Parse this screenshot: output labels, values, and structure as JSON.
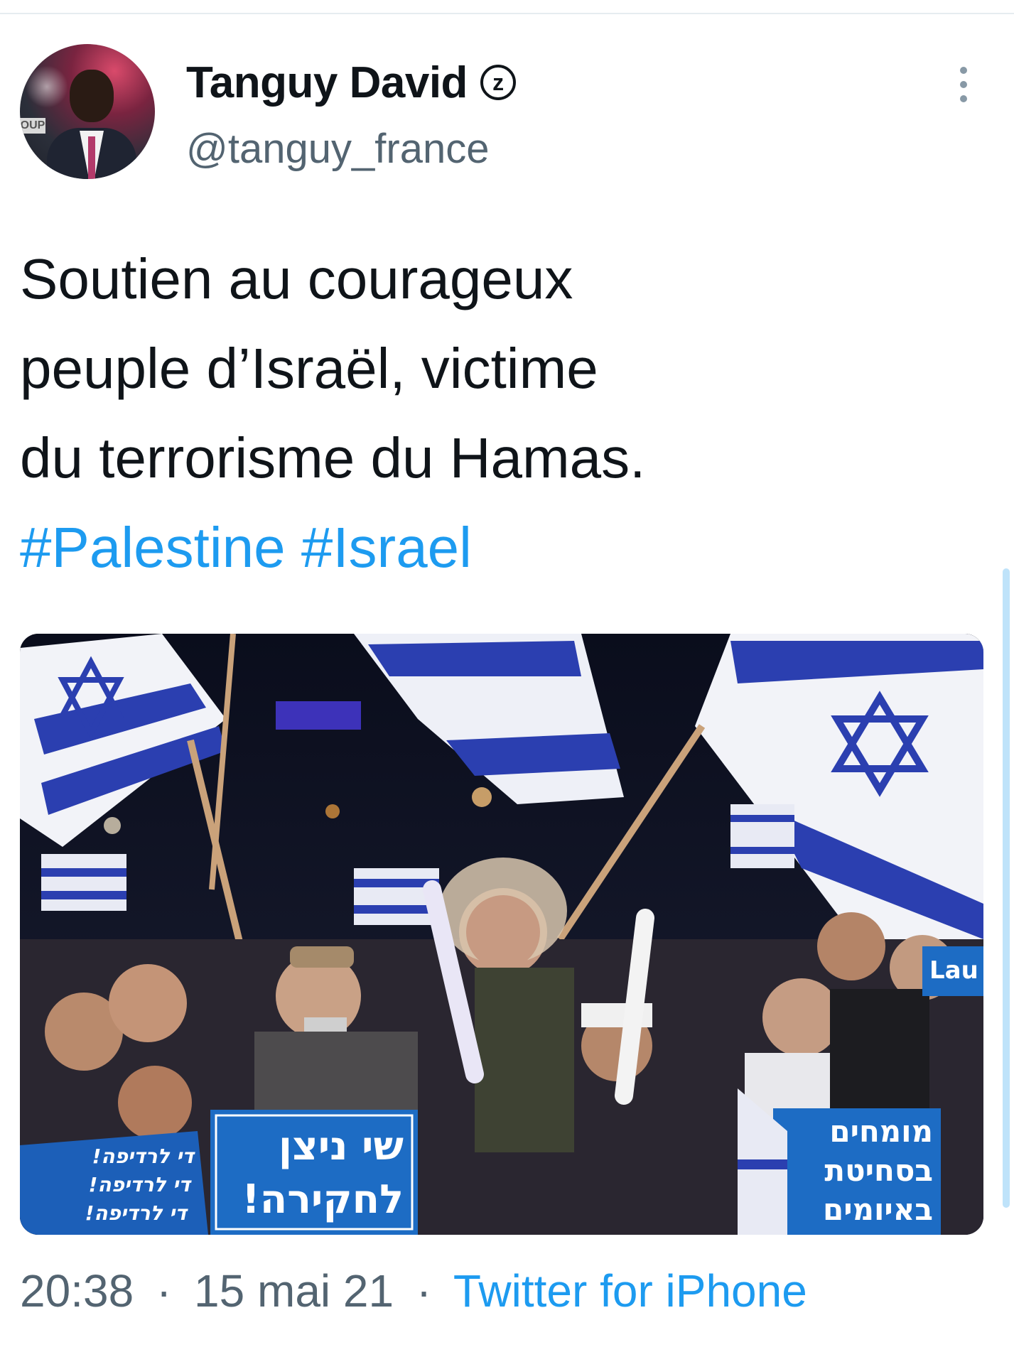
{
  "author": {
    "name": "Tanguy David",
    "badge": "z",
    "handle": "@tanguy_france",
    "avatar_text": "OUP"
  },
  "tweet": {
    "text_lines": [
      "Soutien au courageux",
      "peuple d’Israël, victime",
      "du terrorisme du Hamas."
    ],
    "hashtags": [
      "#Palestine",
      "#Israel"
    ]
  },
  "photo": {
    "description_icon": "crowd-rally-photo",
    "signs": {
      "left_sign": [
        "!די לרדיפה",
        "!די לרדיפה",
        "!די לרדיפה"
      ],
      "center_sign": [
        "שי ניצן",
        "!לחקירה"
      ],
      "right_sign": [
        "מומחים",
        "בסחיטת",
        "באיומים"
      ],
      "far_right_sign": "Lau"
    }
  },
  "meta": {
    "time": "20:38",
    "date": "15 mai 21",
    "separator": "·",
    "source": "Twitter for iPhone"
  },
  "colors": {
    "link": "#1d9bf0",
    "secondary_text": "#536471",
    "flag_blue": "#2b3fb0"
  }
}
